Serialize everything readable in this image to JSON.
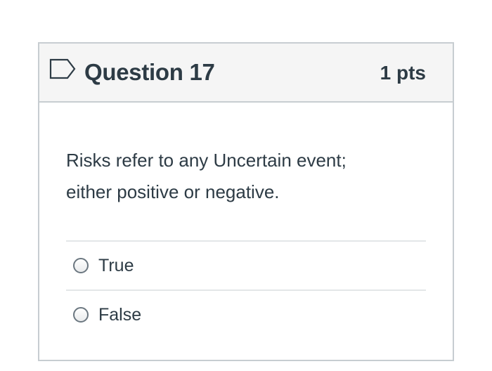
{
  "question": {
    "title": "Question 17",
    "points": "1 pts",
    "text": "Risks refer to any Uncertain event; either positive or negative.",
    "flag_icon": "flag-outline-icon",
    "answers": [
      {
        "label": "True",
        "selected": false
      },
      {
        "label": "False",
        "selected": false
      }
    ]
  },
  "colors": {
    "text": "#2d3b45",
    "border": "#c7cdd1",
    "header_bg": "#f5f5f5",
    "flag": "#2d3b45"
  }
}
